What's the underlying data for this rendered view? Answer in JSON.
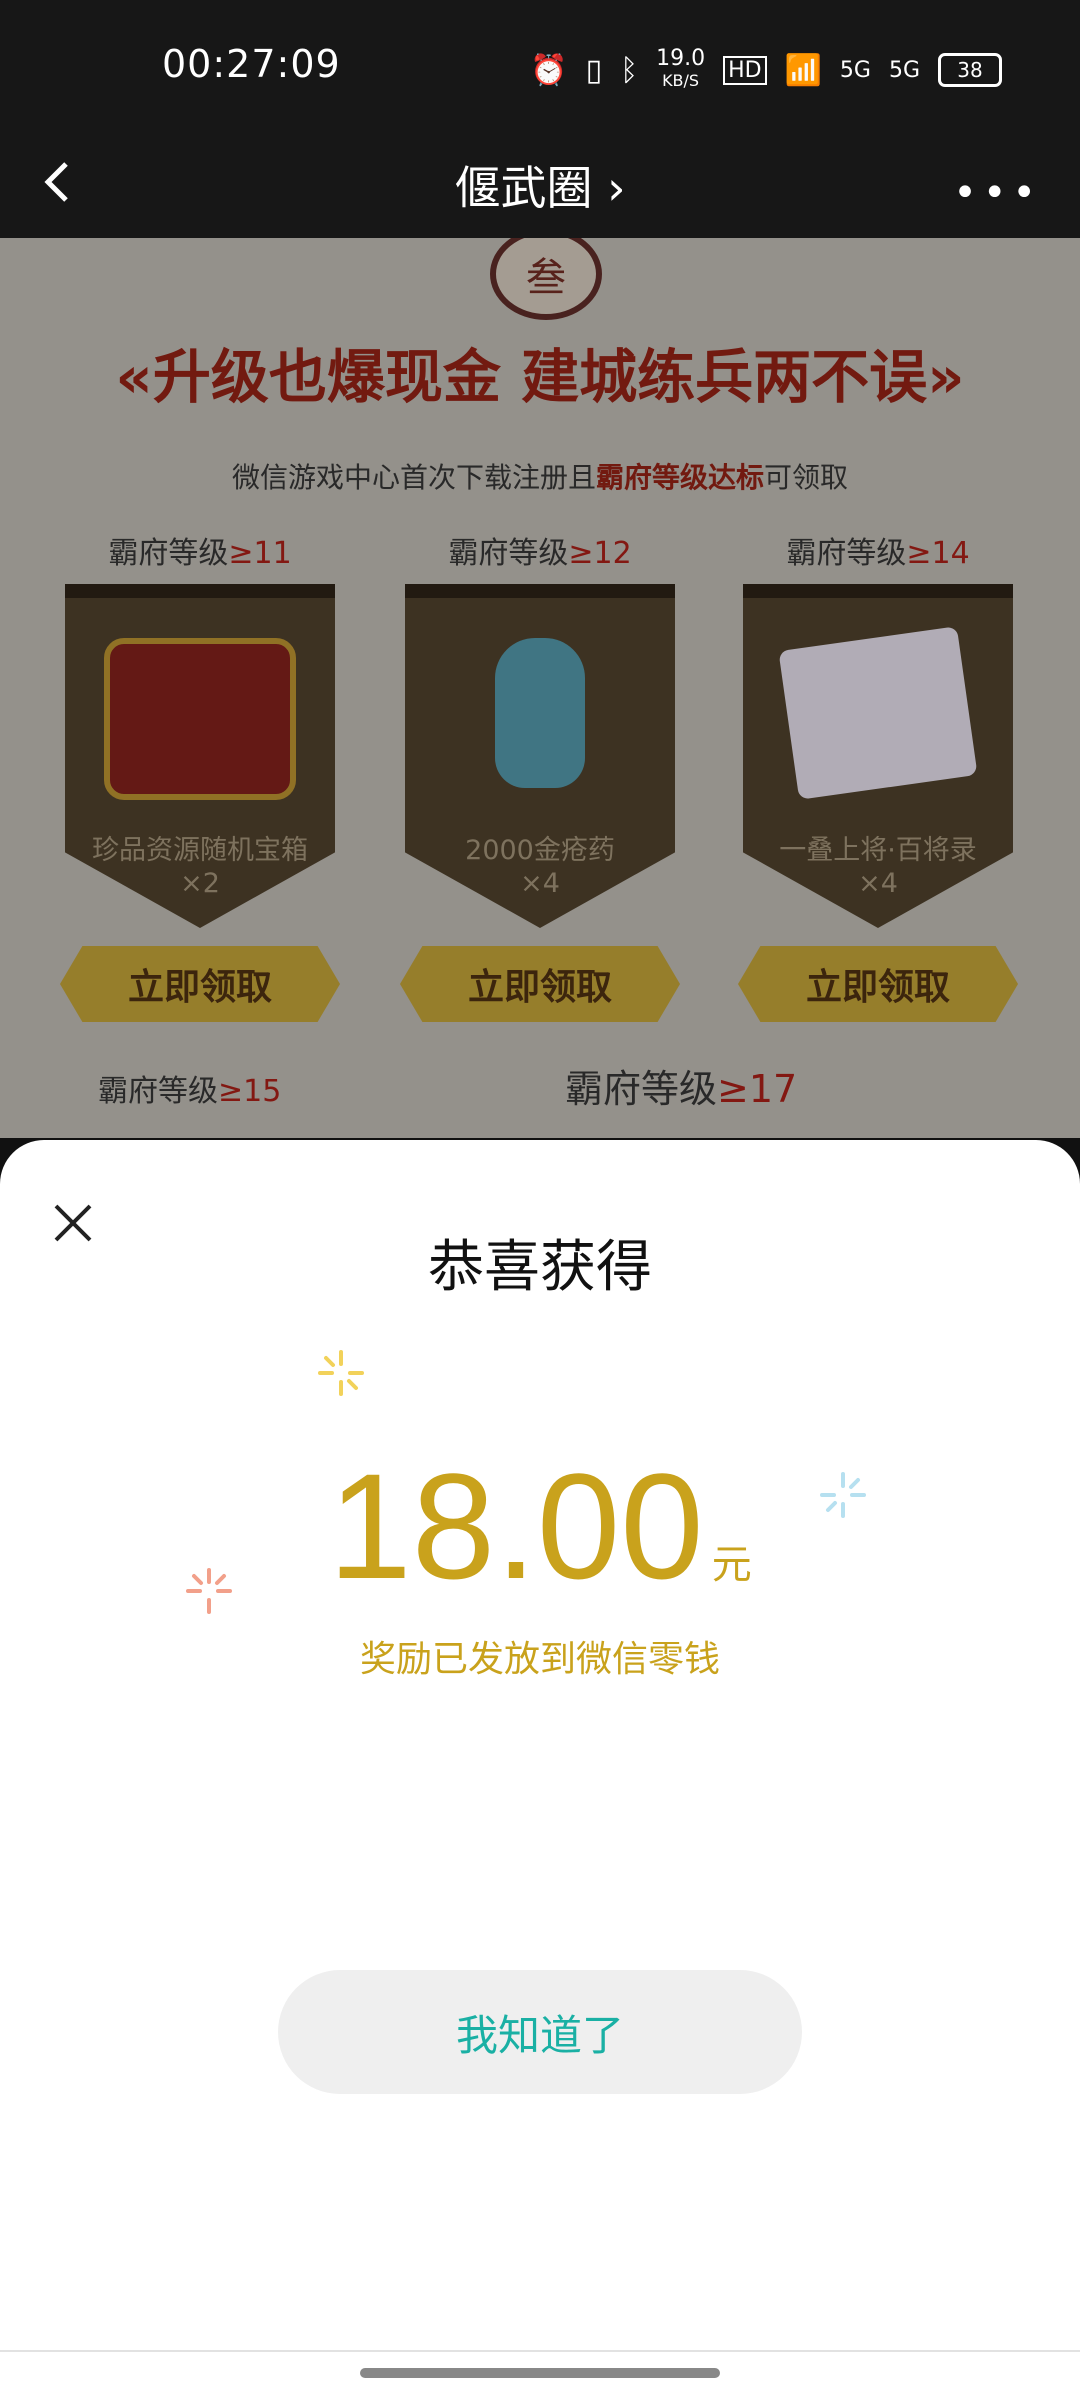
{
  "status": {
    "time": "00:27:09",
    "net_speed": "19.0",
    "net_unit": "KB/S",
    "hd": "HD",
    "sig1": "5G",
    "sig2": "5G",
    "battery": "38"
  },
  "nav": {
    "title": "偃武圈 ›"
  },
  "page": {
    "emblem": "叁",
    "headline": "«升级也爆现金 建城练兵两不误»",
    "sub_prefix": "微信游戏中心首次下载注册且",
    "sub_highlight": "霸府等级达标",
    "sub_suffix": "可领取",
    "cards": [
      {
        "lvl_label": "霸府等级",
        "lvl_num": "≥11",
        "name": "珍品资源随机宝箱",
        "qty": "×2",
        "button": "立即领取"
      },
      {
        "lvl_label": "霸府等级",
        "lvl_num": "≥12",
        "name": "2000金疮药",
        "qty": "×4",
        "button": "立即领取"
      },
      {
        "lvl_label": "霸府等级",
        "lvl_num": "≥14",
        "name": "一叠上将·百将录",
        "qty": "×4",
        "button": "立即领取"
      }
    ],
    "row2": [
      {
        "label": "霸府等级",
        "num": "≥15"
      },
      {
        "label": "霸府等级",
        "num": "≥17"
      }
    ]
  },
  "dialog": {
    "title": "恭喜获得",
    "amount": "18.00",
    "unit": "元",
    "note": "奖励已发放到微信零钱",
    "ok": "我知道了"
  },
  "colors": {
    "gold": "#c9a21c",
    "teal": "#1ab0a4",
    "red": "#a01e16"
  }
}
